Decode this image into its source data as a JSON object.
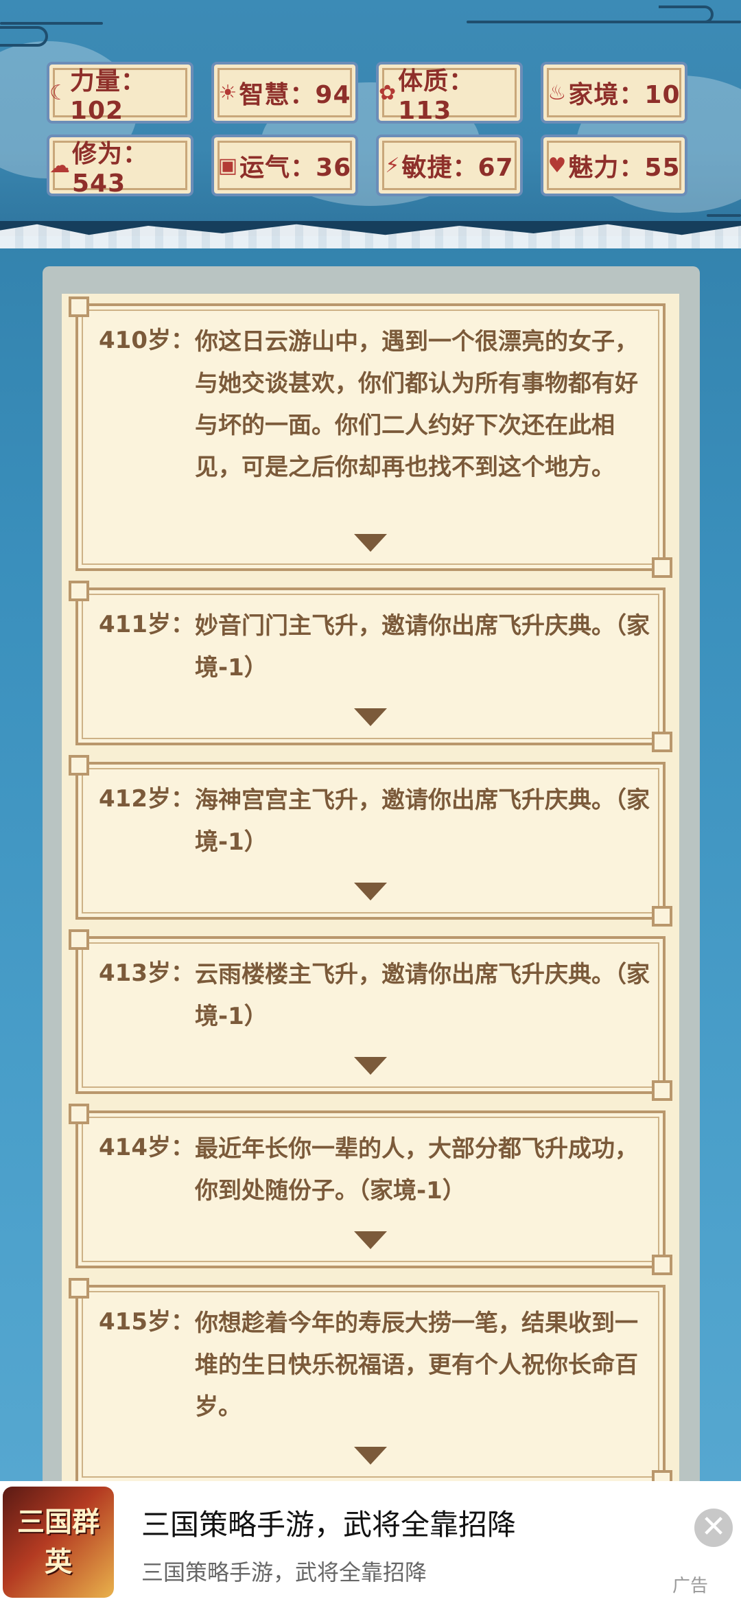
{
  "stats": [
    {
      "icon": "strength-icon",
      "glyph": "☾",
      "text": "力量：102"
    },
    {
      "icon": "wisdom-icon",
      "glyph": "☀",
      "text": "智慧：94"
    },
    {
      "icon": "constitution-icon",
      "glyph": "✿",
      "text": "体质：113"
    },
    {
      "icon": "family-icon",
      "glyph": "♨",
      "text": "家境：10"
    },
    {
      "icon": "cultivation-icon",
      "glyph": "☁",
      "text": "修为：543"
    },
    {
      "icon": "luck-icon",
      "glyph": "▣",
      "text": "运气：36"
    },
    {
      "icon": "agility-icon",
      "glyph": "⚡",
      "text": "敏捷：67"
    },
    {
      "icon": "charm-icon",
      "glyph": "♥",
      "text": "魅力：55"
    }
  ],
  "entries": [
    {
      "age": "410岁：",
      "text": "你这日云游山中，遇到一个很漂亮的女子，与她交谈甚欢，你们都认为所有事物都有好与坏的一面。你们二人约好下次还在此相见，可是之后你却再也找不到这个地方。"
    },
    {
      "age": "411岁：",
      "text": "妙音门门主飞升，邀请你出席飞升庆典。（家境-1）"
    },
    {
      "age": "412岁：",
      "text": "海神宫宫主飞升，邀请你出席飞升庆典。（家境-1）"
    },
    {
      "age": "413岁：",
      "text": "云雨楼楼主飞升，邀请你出席飞升庆典。（家境-1）"
    },
    {
      "age": "414岁：",
      "text": "最近年长你一辈的人，大部分都飞升成功，你到处随份子。（家境-1）"
    },
    {
      "age": "415岁：",
      "text": "你想趁着今年的寿辰大捞一笔，结果收到一堆的生日快乐祝福语，更有个人祝你长命百岁。"
    }
  ],
  "ad": {
    "logo_text": "三国群英",
    "title": "三国策略手游，武将全靠招降",
    "subtitle": "三国策略手游，武将全靠招降",
    "tag": "广告",
    "close_glyph": "✕"
  }
}
